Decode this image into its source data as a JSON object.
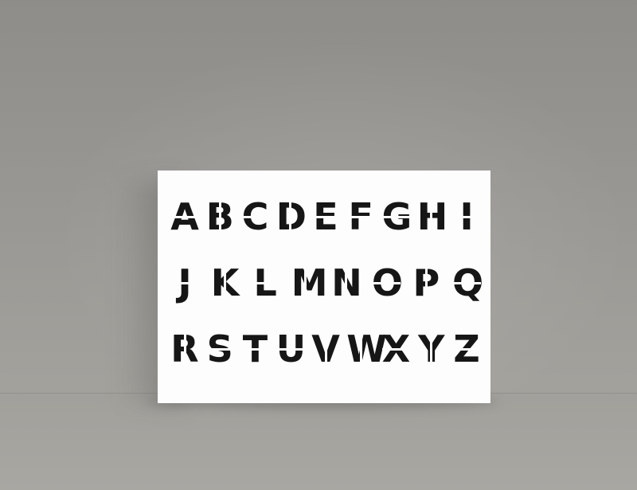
{
  "scene": {
    "wall_color": "#9a9894",
    "floor_color": "#a6a49f",
    "card_color": "#fdfdfd",
    "ink_color": "#161616"
  },
  "alphabet": {
    "row1": [
      "A",
      "B",
      "C",
      "D",
      "E",
      "F",
      "G",
      "H",
      "I"
    ],
    "row2": [
      "J",
      "K",
      "L",
      "M",
      "N",
      "O",
      "P",
      "Q"
    ],
    "row3": [
      "R",
      "S",
      "T",
      "U",
      "V",
      "W",
      "X",
      "Y",
      "Z"
    ]
  }
}
